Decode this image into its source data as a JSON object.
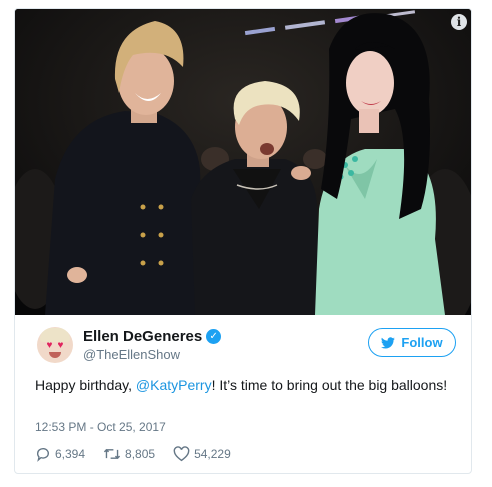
{
  "author": {
    "display_name": "Ellen DeGeneres",
    "handle": "@TheEllenShow",
    "verified": true
  },
  "follow_label": "Follow",
  "tweet": {
    "text_before": "Happy birthday, ",
    "mention": "@KatyPerry",
    "text_after": "! It’s time to bring out the big balloons!"
  },
  "timestamp": "12:53 PM - Oct 25, 2017",
  "stats": {
    "replies": "6,394",
    "retweets": "8,805",
    "likes": "54,229"
  },
  "icons": {
    "info": "info-icon",
    "verified": "verified-badge-icon",
    "follow": "twitter-bird-icon",
    "reply": "reply-icon",
    "retweet": "retweet-icon",
    "like": "heart-icon"
  },
  "colors": {
    "accent": "#1da1f2",
    "link": "#1b95e0",
    "muted": "#657786",
    "text": "#14171a"
  }
}
